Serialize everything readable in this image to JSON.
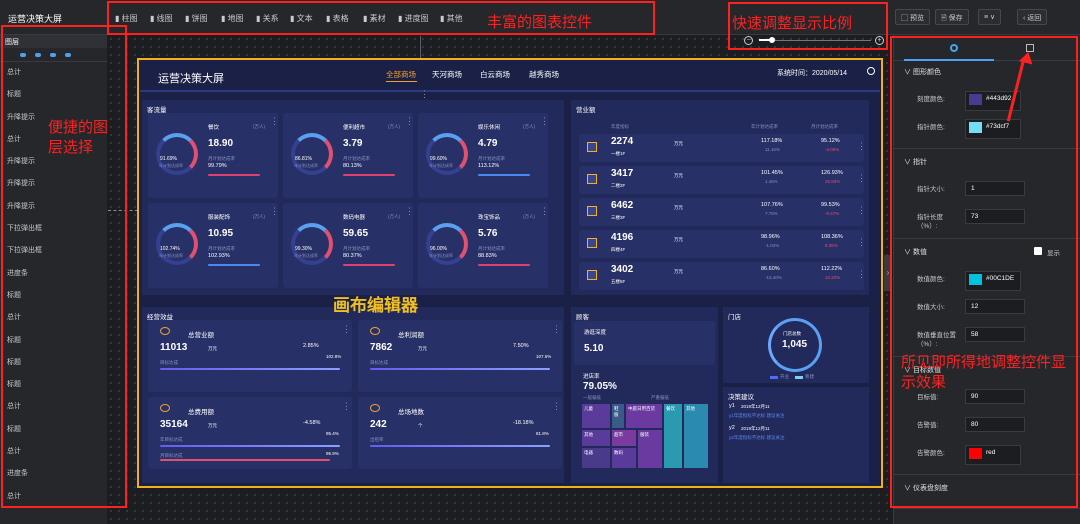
{
  "app_title": "运营决策大屏",
  "toolbar": {
    "items": [
      "柱图",
      "线图",
      "饼图",
      "地图",
      "关系",
      "文本",
      "表格",
      "素材",
      "进度图",
      "其他"
    ],
    "icons": [
      "bar-chart-icon",
      "line-chart-icon",
      "pie-chart-icon",
      "map-icon",
      "relation-icon",
      "text-icon",
      "table-icon",
      "material-icon",
      "progress-icon",
      "more-icon"
    ],
    "preview": "预览",
    "save": "保存",
    "back": "返回"
  },
  "layers": {
    "header": "图层",
    "items": [
      "总计",
      "标题",
      "升降提示",
      "总计",
      "升降提示",
      "升降提示",
      "升降提示",
      "下拉弹出框",
      "下拉弹出框",
      "进度条",
      "标题",
      "总计",
      "标题",
      "标题",
      "标题",
      "总计",
      "标题",
      "总计",
      "进度条",
      "总计"
    ]
  },
  "annotations": {
    "toolbar": "丰富的图表控件",
    "zoom": "快速调整显示比例",
    "layers": "便捷的图层选择",
    "canvas": "画布编辑器",
    "props": "所见即所得地调整控件显示效果"
  },
  "screen": {
    "title": "运营决策大屏",
    "tabs": [
      "全部商场",
      "天河商场",
      "白云商场",
      "越秀商场"
    ],
    "time": "系统时间：2020/05/14",
    "traffic": {
      "title": "客流量",
      "cards": [
        {
          "name": "餐饮",
          "unit": "(万人)",
          "value": "18.90",
          "pct": "91.69%",
          "sub": "月计划达成率",
          "subval": "99.79%",
          "bar": "年计划达成率"
        },
        {
          "name": "便利超市",
          "unit": "(万人)",
          "value": "3.79",
          "pct": "86.81%",
          "sub": "月计划达成率",
          "subval": "80.13%",
          "bar": "年计划达成率"
        },
        {
          "name": "娱乐休闲",
          "unit": "(万人)",
          "value": "4.79",
          "pct": "99.60%",
          "sub": "月计划达成率",
          "subval": "113.12%",
          "bar": "年计划达成率"
        },
        {
          "name": "服装配饰",
          "unit": "(万人)",
          "value": "10.95",
          "pct": "102.74%",
          "sub": "月计划达成率",
          "subval": "102.93%",
          "bar": "年计划达成率"
        },
        {
          "name": "数码电器",
          "unit": "(万人)",
          "value": "59.65",
          "pct": "99.30%",
          "sub": "月计划达成率",
          "subval": "80.37%",
          "bar": "年计划达成率"
        },
        {
          "name": "珠宝饰品",
          "unit": "(万人)",
          "value": "5.76",
          "pct": "96.00%",
          "sub": "月计划达成率",
          "subval": "88.83%",
          "bar": "年计划达成率"
        }
      ]
    },
    "sales": {
      "title": "营业额",
      "head": [
        "年度指标",
        "年计划达成率",
        "月计划达成率"
      ],
      "rows": [
        {
          "value": "2274",
          "unit": "万元",
          "floor": "一楼1F",
          "yr": "117.18%",
          "yr2": "11.16%",
          "mo": "95.12%",
          "mo2": "-4.06%"
        },
        {
          "value": "3417",
          "unit": "万元",
          "floor": "二楼2F",
          "yr": "101.45%",
          "yr2": "1.46%",
          "mo": "126.93%",
          "mo2": "26.93%"
        },
        {
          "value": "6462",
          "unit": "万元",
          "floor": "三楼3F",
          "yr": "107.76%",
          "yr2": "7.76%",
          "mo": "99.53%",
          "mo2": "-0.47%"
        },
        {
          "value": "4196",
          "unit": "万元",
          "floor": "四楼4F",
          "yr": "98.96%",
          "yr2": "-1.04%",
          "mo": "108.36%",
          "mo2": "8.36%"
        },
        {
          "value": "3402",
          "unit": "万元",
          "floor": "五楼5F",
          "yr": "86.60%",
          "yr2": "-13.40%",
          "mo": "112.22%",
          "mo2": "12.22%"
        }
      ]
    },
    "performance": {
      "title": "经营效益",
      "cards": [
        {
          "name": "总营业额",
          "value": "11013",
          "unit": "万元",
          "pct": "2.85%",
          "total": "102.8%",
          "label": "目标达成"
        },
        {
          "name": "总利润额",
          "value": "7862",
          "unit": "万元",
          "pct": "7.50%",
          "total": "107.5%",
          "label": "目标达成"
        },
        {
          "name": "总费用额",
          "value": "35164",
          "unit": "万元",
          "pct": "-4.58%",
          "total": "95.4%",
          "label": "年目标达成",
          "label2": "月目标达成",
          "total2": "95.9%"
        },
        {
          "name": "总场地数",
          "value": "242",
          "unit": "个",
          "pct": "-18.18%",
          "total": "81.8%",
          "label": "出租率"
        }
      ]
    },
    "customer": {
      "title": "顾客",
      "depth_label": "游逛深度",
      "depth": "5.10",
      "rate_label": "进店率",
      "rate": "79.05%",
      "tree_head": [
        "一般偏低",
        "严重偏低"
      ],
      "tree": [
        "儿童",
        "鞋服",
        "中庭日用百货",
        "餐饮",
        "其他",
        "超市",
        "服装",
        "电器",
        "数码",
        "其他"
      ]
    },
    "store": {
      "title": "门店",
      "total_label": "门店总数",
      "total": "1,045",
      "legend": [
        "开业",
        "筹建"
      ]
    },
    "advice": {
      "title": "决策建议",
      "items": [
        {
          "id": "y1",
          "date": "2019年12月11",
          "text": "y1年度指标不达标 建议关注"
        },
        {
          "id": "y2",
          "date": "2019年12月11",
          "text": "y2年度指标不达标 建议关注"
        }
      ]
    }
  },
  "props": {
    "sections": [
      {
        "title": "图形颜色",
        "rows": [
          {
            "label": "刻度颜色:",
            "color": "#443d92",
            "text": "#443d92"
          },
          {
            "label": "指针颜色:",
            "color": "#73dcf7",
            "text": "#73dcf7"
          }
        ]
      },
      {
        "title": "指针",
        "rows": [
          {
            "label": "指针大小:",
            "value": "1"
          },
          {
            "label": "指针长度（%）:",
            "value": "73"
          }
        ]
      },
      {
        "title": "数值",
        "toggle": "显示",
        "rows": [
          {
            "label": "数值颜色:",
            "color": "#00C1DE",
            "text": "#00C1DE"
          },
          {
            "label": "数值大小:",
            "value": "12"
          },
          {
            "label": "数值垂直位置（%）:",
            "value": "58"
          }
        ]
      },
      {
        "title": "目标数值",
        "rows": [
          {
            "label": "目标值:",
            "value": "90"
          },
          {
            "label": "告警值:",
            "value": "80"
          },
          {
            "label": "告警颜色:",
            "color": "#ff0000",
            "text": "red"
          }
        ]
      },
      {
        "title": "仪表盘刻度",
        "rows": []
      }
    ]
  },
  "colors": {
    "accent": "#ff2020",
    "screen_border": "#f0b020",
    "gauge_accent": "#e05070"
  }
}
